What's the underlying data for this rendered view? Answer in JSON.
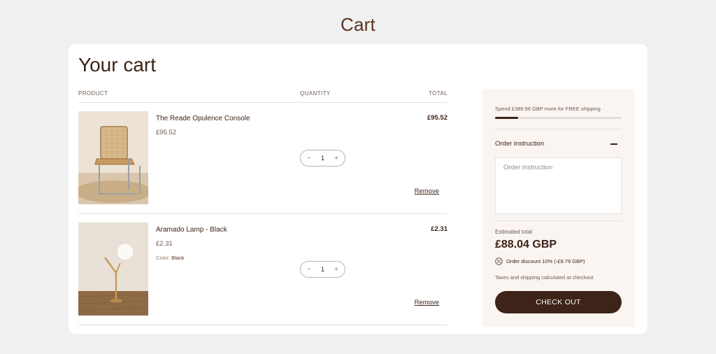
{
  "page": {
    "heading": "Cart"
  },
  "cart": {
    "title": "Your cart",
    "columns": {
      "product": "PRODUCT",
      "quantity": "QUANTITY",
      "total": "TOTAL"
    },
    "items": [
      {
        "name": "The Reade Opulence Console",
        "price": "£95.52",
        "quantity": "1",
        "line_total": "£95.52",
        "remove_label": "Remove",
        "image": "chair-photo"
      },
      {
        "name": "Aramado Lamp - Black",
        "price": "£2.31",
        "variant_label": "Color:",
        "variant_value": "Black",
        "quantity": "1",
        "line_total": "£2.31",
        "remove_label": "Remove",
        "image": "lamp-photo"
      }
    ],
    "stepper": {
      "minus": "−",
      "plus": "+"
    }
  },
  "summary": {
    "shipping_text": "Spend £389.96 GBP more for FREE shipping",
    "shipping_progress": 0.18,
    "order_instruction": {
      "title": "Order instruction",
      "placeholder": "Order instruction"
    },
    "estimated_label": "Estimated total",
    "estimated_value": "£88.04 GBP",
    "discount_text": "Order discount 10% (-£9.79 GBP)",
    "tax_note": "Taxes and shipping calculated at checkout",
    "checkout_label": "CHECK OUT"
  },
  "colors": {
    "brand": "#3d2318",
    "background": "#f0f0f0",
    "panel": "#faf5f1"
  }
}
